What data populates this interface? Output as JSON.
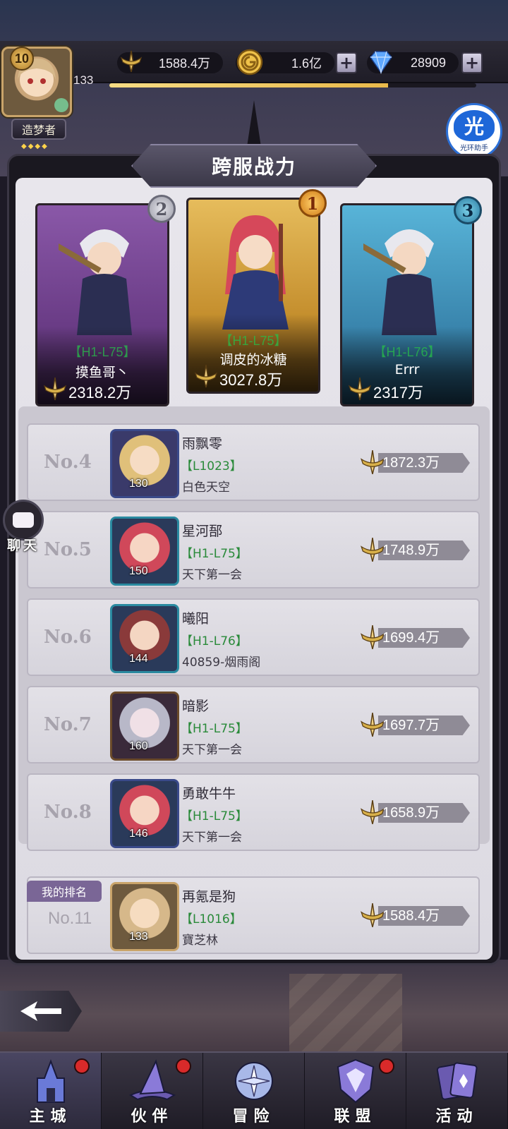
{
  "resources": {
    "power": "1588.4万",
    "gold": "1.6亿",
    "diamonds": "28909"
  },
  "player": {
    "vip_level": "10",
    "power_short": "133",
    "title": "造梦者",
    "exp_progress": 0.76
  },
  "helper": {
    "badge": "光",
    "label": "光环助手"
  },
  "panel": {
    "title": "跨服战力"
  },
  "podium": [
    {
      "rank": "2",
      "server": "【H1-L75】",
      "name": "摸鱼哥丶",
      "power": "2318.2万"
    },
    {
      "rank": "1",
      "server": "【H1-L75】",
      "name": "调皮的冰糖",
      "power": "3027.8万"
    },
    {
      "rank": "3",
      "server": "【H1-L76】",
      "name": "Errr",
      "power": "2317万"
    }
  ],
  "rankings": [
    {
      "rank": "No.4",
      "level": "130",
      "name": "雨飘零",
      "server": "【L1023】",
      "guild": "白色天空",
      "power": "1872.3万"
    },
    {
      "rank": "No.5",
      "level": "150",
      "name": "星河郚",
      "server": "【H1-L75】",
      "guild": "天下第一会",
      "power": "1748.9万"
    },
    {
      "rank": "No.6",
      "level": "144",
      "name": "曦阳",
      "server": "【H1-L76】",
      "guild": "40859-烟雨阁",
      "power": "1699.4万"
    },
    {
      "rank": "No.7",
      "level": "160",
      "name": "暗影",
      "server": "【H1-L75】",
      "guild": "天下第一会",
      "power": "1697.7万"
    },
    {
      "rank": "No.8",
      "level": "146",
      "name": "勇敢牛牛",
      "server": "【H1-L75】",
      "guild": "天下第一会",
      "power": "1658.9万"
    }
  ],
  "my_rank": {
    "tag": "我的排名",
    "rank": "No.11",
    "level": "133",
    "name": "再氪是狗",
    "server": "【L1016】",
    "guild": "寶芝林",
    "power": "1588.4万"
  },
  "chat": {
    "label": "聊天"
  },
  "nav": [
    {
      "label": "主城",
      "icon": "castle-icon",
      "badge": true,
      "active": true
    },
    {
      "label": "伙伴",
      "icon": "witch-hat-icon",
      "badge": true,
      "active": false
    },
    {
      "label": "冒险",
      "icon": "compass-icon",
      "badge": false,
      "active": false
    },
    {
      "label": "联盟",
      "icon": "shield-icon",
      "badge": true,
      "active": false
    },
    {
      "label": "活动",
      "icon": "cards-icon",
      "badge": false,
      "active": false
    }
  ],
  "colors": {
    "server_green": "#2a8a3a",
    "gold_card": "#e6bc5c",
    "purple_card": "#8a58a8",
    "blue_card": "#58b4d8",
    "badge_red": "#d92a2a"
  }
}
